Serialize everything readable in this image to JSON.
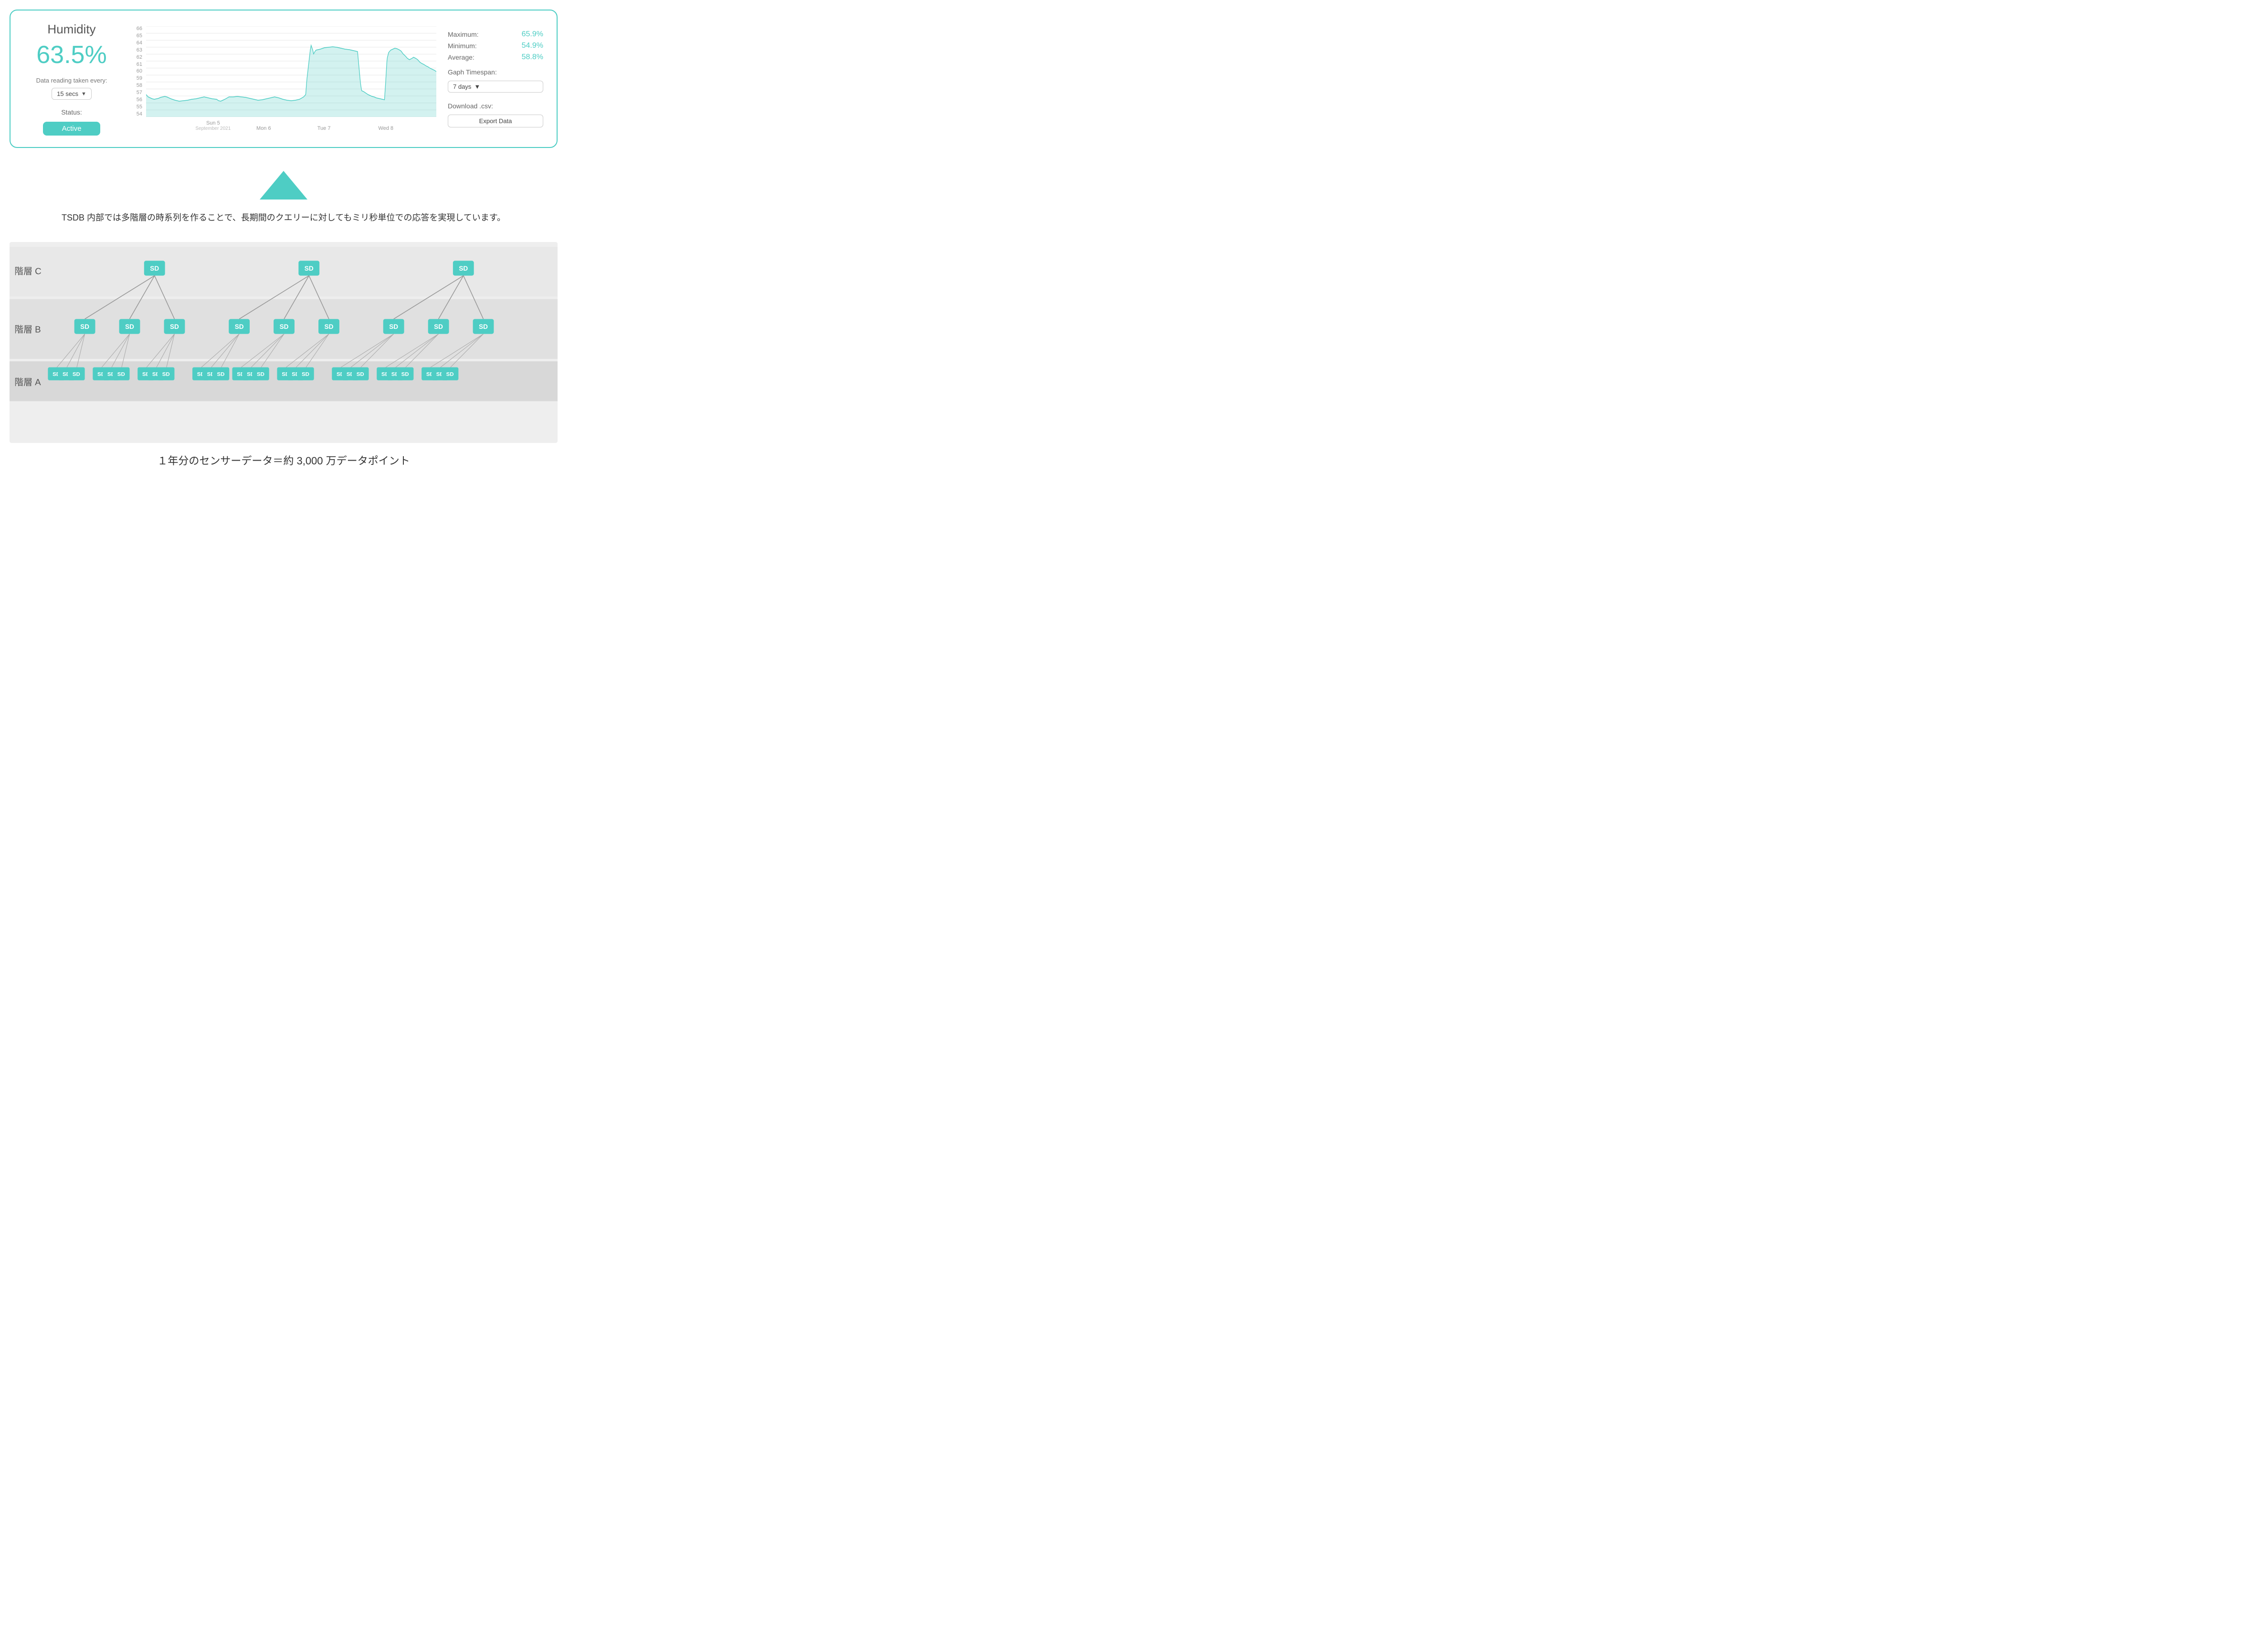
{
  "card": {
    "title": "Humidity",
    "value": "63.5%",
    "reading_label": "Data reading taken every:",
    "interval": "15 secs",
    "status_label": "Status:",
    "status": "Active",
    "stats": {
      "maximum_label": "Maximum:",
      "maximum_value": "65.9%",
      "minimum_label": "Minimum:",
      "minimum_value": "54.9%",
      "average_label": "Average:",
      "average_value": "58.8%"
    },
    "timespan_label": "Gaph Timespan:",
    "timespan": "7 days",
    "download_label": "Download .csv:",
    "export_btn": "Export Data"
  },
  "chart": {
    "y_ticks": [
      "66",
      "65",
      "64",
      "63",
      "62",
      "61",
      "60",
      "59",
      "58",
      "57",
      "56",
      "55",
      "54"
    ],
    "x_labels": [
      {
        "text": "Sun 5",
        "sub": "September 2021",
        "pct": "17"
      },
      {
        "text": "Mon 6",
        "sub": "",
        "pct": "38"
      },
      {
        "text": "Tue 7",
        "sub": "",
        "pct": "59"
      },
      {
        "text": "Wed 8",
        "sub": "",
        "pct": "80"
      }
    ]
  },
  "arrow": {},
  "jp_text": "TSDB 内部では多階層の時系列を作ることで、長期間のクエリーに対してもミリ秒単位での応答を実現しています。",
  "tree": {
    "layer_c_label": "階層 C",
    "layer_b_label": "階層 B",
    "layer_a_label": "階層 A",
    "layer_c_nodes": 3,
    "layer_b_nodes": 9,
    "layer_a_nodes": 27,
    "node_label": "SD"
  },
  "footer": "１年分のセンサーデータ＝約 3,000 万データポイント"
}
